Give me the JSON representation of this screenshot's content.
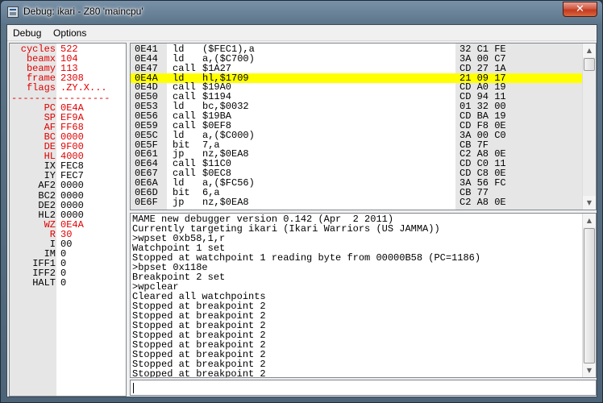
{
  "window": {
    "title": "Debug: ikari - Z80 'maincpu'",
    "close_glyph": "✕"
  },
  "menu": [
    {
      "label": "Debug"
    },
    {
      "label": "Options"
    }
  ],
  "registers": [
    {
      "name": "cycles",
      "value": "522",
      "name_color": "red",
      "value_color": "red"
    },
    {
      "name": "beamx",
      "value": "104",
      "name_color": "red",
      "value_color": "red"
    },
    {
      "name": "beamy",
      "value": "113",
      "name_color": "red",
      "value_color": "red"
    },
    {
      "name": "frame",
      "value": "2308",
      "name_color": "red",
      "value_color": "red"
    },
    {
      "name": "flags",
      "value": ".ZY.X...",
      "name_color": "red",
      "value_color": "red"
    },
    {
      "name": "PC",
      "value": "0E4A",
      "name_color": "red",
      "value_color": "red"
    },
    {
      "name": "SP",
      "value": "EF9A",
      "name_color": "red",
      "value_color": "red"
    },
    {
      "name": "AF",
      "value": "FF68",
      "name_color": "red",
      "value_color": "red"
    },
    {
      "name": "BC",
      "value": "0000",
      "name_color": "red",
      "value_color": "red"
    },
    {
      "name": "DE",
      "value": "9F00",
      "name_color": "red",
      "value_color": "red"
    },
    {
      "name": "HL",
      "value": "4000",
      "name_color": "red",
      "value_color": "red"
    },
    {
      "name": "IX",
      "value": "FEC8",
      "name_color": "black",
      "value_color": "black"
    },
    {
      "name": "IY",
      "value": "FEC7",
      "name_color": "black",
      "value_color": "black"
    },
    {
      "name": "AF2",
      "value": "0000",
      "name_color": "black",
      "value_color": "black"
    },
    {
      "name": "BC2",
      "value": "0000",
      "name_color": "black",
      "value_color": "black"
    },
    {
      "name": "DE2",
      "value": "0000",
      "name_color": "black",
      "value_color": "black"
    },
    {
      "name": "HL2",
      "value": "0000",
      "name_color": "black",
      "value_color": "black"
    },
    {
      "name": "WZ",
      "value": "0E4A",
      "name_color": "red",
      "value_color": "red"
    },
    {
      "name": "R",
      "value": "30",
      "name_color": "red",
      "value_color": "red"
    },
    {
      "name": "I",
      "value": "00",
      "name_color": "black",
      "value_color": "black"
    },
    {
      "name": "IM",
      "value": "0",
      "name_color": "black",
      "value_color": "black"
    },
    {
      "name": "IFF1",
      "value": "0",
      "name_color": "black",
      "value_color": "black"
    },
    {
      "name": "IFF2",
      "value": "0",
      "name_color": "black",
      "value_color": "black"
    },
    {
      "name": "HALT",
      "value": "0",
      "name_color": "black",
      "value_color": "black"
    }
  ],
  "separator": "-----------------",
  "disassembly": [
    {
      "addr": "0E41",
      "mnem": "ld",
      "ops": "($FEC1),a",
      "bytes": "32 C1 FE",
      "current": false
    },
    {
      "addr": "0E44",
      "mnem": "ld",
      "ops": "a,($C700)",
      "bytes": "3A 00 C7",
      "current": false
    },
    {
      "addr": "0E47",
      "mnem": "call",
      "ops": "$1A27",
      "bytes": "CD 27 1A",
      "current": false
    },
    {
      "addr": "0E4A",
      "mnem": "ld",
      "ops": "hl,$1709",
      "bytes": "21 09 17",
      "current": true
    },
    {
      "addr": "0E4D",
      "mnem": "call",
      "ops": "$19A0",
      "bytes": "CD A0 19",
      "current": false
    },
    {
      "addr": "0E50",
      "mnem": "call",
      "ops": "$1194",
      "bytes": "CD 94 11",
      "current": false
    },
    {
      "addr": "0E53",
      "mnem": "ld",
      "ops": "bc,$0032",
      "bytes": "01 32 00",
      "current": false
    },
    {
      "addr": "0E56",
      "mnem": "call",
      "ops": "$19BA",
      "bytes": "CD BA 19",
      "current": false
    },
    {
      "addr": "0E59",
      "mnem": "call",
      "ops": "$0EF8",
      "bytes": "CD F8 0E",
      "current": false
    },
    {
      "addr": "0E5C",
      "mnem": "ld",
      "ops": "a,($C000)",
      "bytes": "3A 00 C0",
      "current": false
    },
    {
      "addr": "0E5F",
      "mnem": "bit",
      "ops": "7,a",
      "bytes": "CB 7F",
      "current": false
    },
    {
      "addr": "0E61",
      "mnem": "jp",
      "ops": "nz,$0EA8",
      "bytes": "C2 A8 0E",
      "current": false
    },
    {
      "addr": "0E64",
      "mnem": "call",
      "ops": "$11C0",
      "bytes": "CD C0 11",
      "current": false
    },
    {
      "addr": "0E67",
      "mnem": "call",
      "ops": "$0EC8",
      "bytes": "CD C8 0E",
      "current": false
    },
    {
      "addr": "0E6A",
      "mnem": "ld",
      "ops": "a,($FC56)",
      "bytes": "3A 56 FC",
      "current": false
    },
    {
      "addr": "0E6D",
      "mnem": "bit",
      "ops": "6,a",
      "bytes": "CB 77",
      "current": false
    },
    {
      "addr": "0E6F",
      "mnem": "jp",
      "ops": "nz,$0EA8",
      "bytes": "C2 A8 0E",
      "current": false
    }
  ],
  "console": [
    "MAME new debugger version 0.142 (Apr  2 2011)",
    "Currently targeting ikari (Ikari Warriors (US JAMMA))",
    ">wpset 0xb58,1,r",
    "Watchpoint 1 set",
    "Stopped at watchpoint 1 reading byte from 00000B58 (PC=1186)",
    ">bpset 0x118e",
    "Breakpoint 2 set",
    ">wpclear",
    "Cleared all watchpoints",
    "Stopped at breakpoint 2",
    "Stopped at breakpoint 2",
    "Stopped at breakpoint 2",
    "Stopped at breakpoint 2",
    "Stopped at breakpoint 2",
    "Stopped at breakpoint 2",
    "Stopped at breakpoint 2",
    "Stopped at breakpoint 2",
    "Stopped at breakpoint 2"
  ],
  "command_input": {
    "value": ""
  },
  "icons": {
    "scroll_up": "▲",
    "scroll_down": "▼"
  },
  "colors": {
    "highlight": "#ffff00",
    "changed_register": "#e00000",
    "label_column": "#e6e6e6"
  }
}
